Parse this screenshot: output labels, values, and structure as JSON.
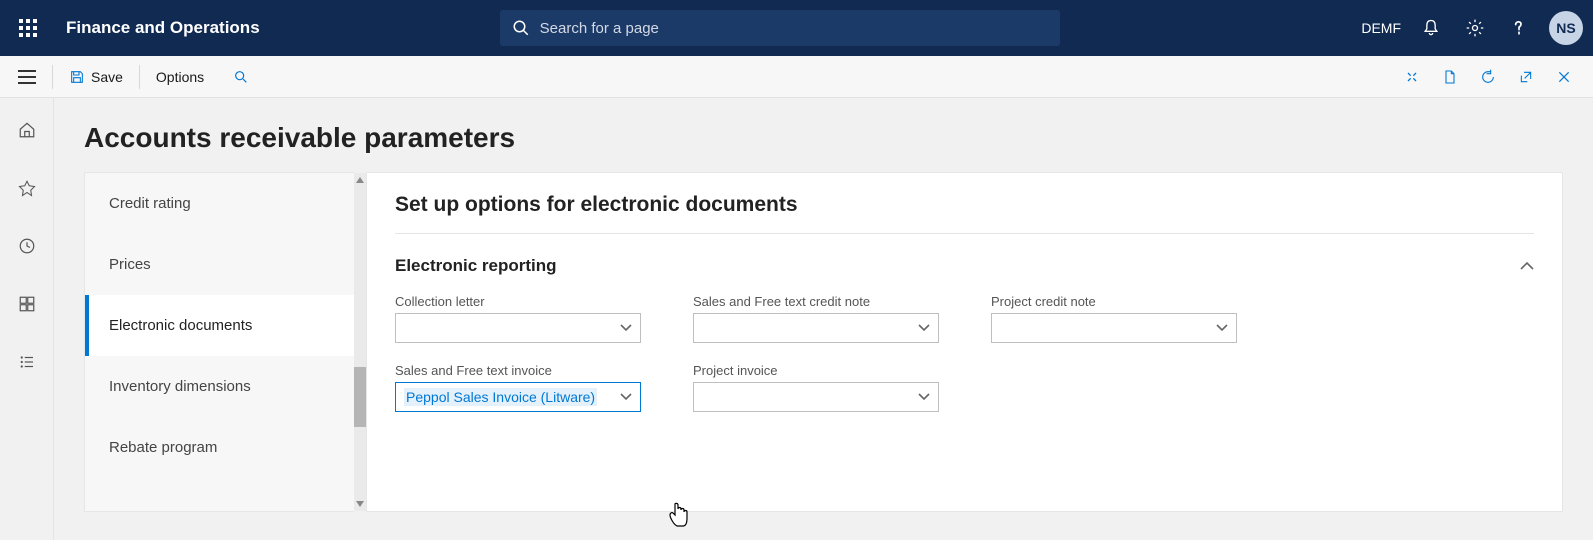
{
  "header": {
    "brand": "Finance and Operations",
    "search_placeholder": "Search for a page",
    "company": "DEMF",
    "avatar_initials": "NS"
  },
  "toolbar": {
    "save_label": "Save",
    "options_label": "Options"
  },
  "page": {
    "title": "Accounts receivable parameters"
  },
  "sidepanel": {
    "items": [
      {
        "label": "Credit rating"
      },
      {
        "label": "Prices"
      },
      {
        "label": "Electronic documents"
      },
      {
        "label": "Inventory dimensions"
      },
      {
        "label": "Rebate program"
      }
    ],
    "active_index": 2
  },
  "detail": {
    "title": "Set up options for electronic documents",
    "group_title": "Electronic reporting",
    "fields": {
      "collection_letter": {
        "label": "Collection letter",
        "value": ""
      },
      "sales_credit_note": {
        "label": "Sales and Free text credit note",
        "value": ""
      },
      "project_credit_note": {
        "label": "Project credit note",
        "value": ""
      },
      "sales_invoice": {
        "label": "Sales and Free text invoice",
        "value": "Peppol Sales Invoice (Litware)"
      },
      "project_invoice": {
        "label": "Project invoice",
        "value": ""
      }
    }
  }
}
